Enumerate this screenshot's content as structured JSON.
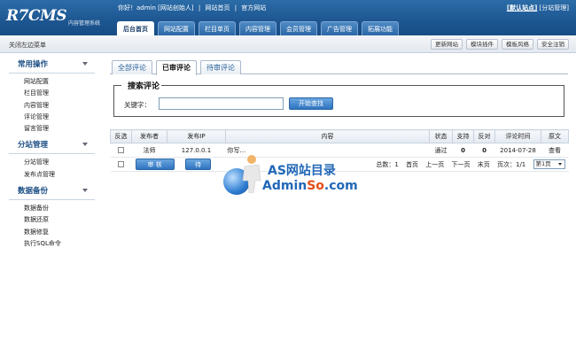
{
  "header": {
    "logo": "R7CMS",
    "logo_sub": "内容管理系统",
    "top_links": [
      "你好！admin [网站创始人]",
      "|",
      "网站首页",
      "|",
      "官方网站"
    ],
    "right_link_bold": "[默认站点]",
    "right_link": "[分站管理]",
    "main_tabs": [
      "后台首页",
      "网站配置",
      "栏目单页",
      "内容管理",
      "会员管理",
      "广告管理",
      "拓展功能"
    ]
  },
  "subbar": {
    "close_menu": "关闭左边菜单",
    "buttons": [
      "更新网站",
      "模块插件",
      "模板风格",
      "安全注销"
    ]
  },
  "sidebar": {
    "groups": [
      {
        "title": "常用操作",
        "items": [
          "网站配置",
          "栏目管理",
          "内容管理",
          "评论管理",
          "留言管理"
        ]
      },
      {
        "title": "分站管理",
        "items": [
          "分站管理",
          "发布点管理"
        ]
      },
      {
        "title": "数据备份",
        "items": [
          "数据备份",
          "数据还原",
          "数据修复",
          "执行SQL命令"
        ]
      }
    ]
  },
  "content": {
    "tabs": [
      "全部评论",
      "已审评论",
      "待审评论"
    ],
    "search": {
      "legend": "搜索评论",
      "keyword_label": "关键字：",
      "keyword_value": "",
      "button": "开始查找"
    },
    "table": {
      "headers": [
        "反选",
        "发布者",
        "发布IP",
        "内容",
        "状态",
        "支持",
        "反对",
        "评论时间",
        "原文"
      ],
      "rows": [
        {
          "author": "法师",
          "ip": "127.0.0.1",
          "content": "你写...",
          "status": "通过",
          "support": "0",
          "oppose": "0",
          "time": "2014-07-28",
          "view": "查看"
        }
      ],
      "actions": [
        "审 核",
        "待"
      ],
      "pager": {
        "total_label": "总数：1",
        "first": "首页",
        "prev": "上一页",
        "next": "下一页",
        "last": "末页",
        "page_label": "页次：1/1",
        "select_value": "第1页"
      }
    }
  },
  "watermark": {
    "line1": "AS网站目录",
    "line2_a": "Admin",
    "line2_o": "So",
    "line2_b": ".com"
  }
}
